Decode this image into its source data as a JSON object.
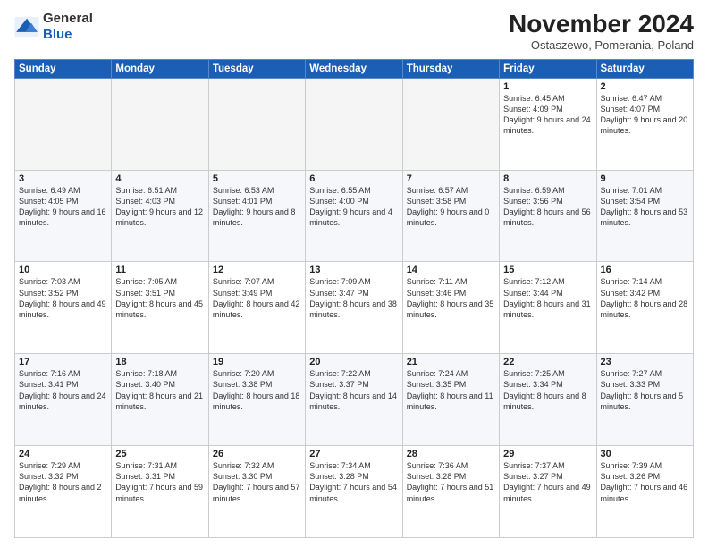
{
  "logo": {
    "general": "General",
    "blue": "Blue"
  },
  "title": "November 2024",
  "subtitle": "Ostaszewo, Pomerania, Poland",
  "weekdays": [
    "Sunday",
    "Monday",
    "Tuesday",
    "Wednesday",
    "Thursday",
    "Friday",
    "Saturday"
  ],
  "weeks": [
    [
      {
        "day": "",
        "info": ""
      },
      {
        "day": "",
        "info": ""
      },
      {
        "day": "",
        "info": ""
      },
      {
        "day": "",
        "info": ""
      },
      {
        "day": "",
        "info": ""
      },
      {
        "day": "1",
        "info": "Sunrise: 6:45 AM\nSunset: 4:09 PM\nDaylight: 9 hours and 24 minutes."
      },
      {
        "day": "2",
        "info": "Sunrise: 6:47 AM\nSunset: 4:07 PM\nDaylight: 9 hours and 20 minutes."
      }
    ],
    [
      {
        "day": "3",
        "info": "Sunrise: 6:49 AM\nSunset: 4:05 PM\nDaylight: 9 hours and 16 minutes."
      },
      {
        "day": "4",
        "info": "Sunrise: 6:51 AM\nSunset: 4:03 PM\nDaylight: 9 hours and 12 minutes."
      },
      {
        "day": "5",
        "info": "Sunrise: 6:53 AM\nSunset: 4:01 PM\nDaylight: 9 hours and 8 minutes."
      },
      {
        "day": "6",
        "info": "Sunrise: 6:55 AM\nSunset: 4:00 PM\nDaylight: 9 hours and 4 minutes."
      },
      {
        "day": "7",
        "info": "Sunrise: 6:57 AM\nSunset: 3:58 PM\nDaylight: 9 hours and 0 minutes."
      },
      {
        "day": "8",
        "info": "Sunrise: 6:59 AM\nSunset: 3:56 PM\nDaylight: 8 hours and 56 minutes."
      },
      {
        "day": "9",
        "info": "Sunrise: 7:01 AM\nSunset: 3:54 PM\nDaylight: 8 hours and 53 minutes."
      }
    ],
    [
      {
        "day": "10",
        "info": "Sunrise: 7:03 AM\nSunset: 3:52 PM\nDaylight: 8 hours and 49 minutes."
      },
      {
        "day": "11",
        "info": "Sunrise: 7:05 AM\nSunset: 3:51 PM\nDaylight: 8 hours and 45 minutes."
      },
      {
        "day": "12",
        "info": "Sunrise: 7:07 AM\nSunset: 3:49 PM\nDaylight: 8 hours and 42 minutes."
      },
      {
        "day": "13",
        "info": "Sunrise: 7:09 AM\nSunset: 3:47 PM\nDaylight: 8 hours and 38 minutes."
      },
      {
        "day": "14",
        "info": "Sunrise: 7:11 AM\nSunset: 3:46 PM\nDaylight: 8 hours and 35 minutes."
      },
      {
        "day": "15",
        "info": "Sunrise: 7:12 AM\nSunset: 3:44 PM\nDaylight: 8 hours and 31 minutes."
      },
      {
        "day": "16",
        "info": "Sunrise: 7:14 AM\nSunset: 3:42 PM\nDaylight: 8 hours and 28 minutes."
      }
    ],
    [
      {
        "day": "17",
        "info": "Sunrise: 7:16 AM\nSunset: 3:41 PM\nDaylight: 8 hours and 24 minutes."
      },
      {
        "day": "18",
        "info": "Sunrise: 7:18 AM\nSunset: 3:40 PM\nDaylight: 8 hours and 21 minutes."
      },
      {
        "day": "19",
        "info": "Sunrise: 7:20 AM\nSunset: 3:38 PM\nDaylight: 8 hours and 18 minutes."
      },
      {
        "day": "20",
        "info": "Sunrise: 7:22 AM\nSunset: 3:37 PM\nDaylight: 8 hours and 14 minutes."
      },
      {
        "day": "21",
        "info": "Sunrise: 7:24 AM\nSunset: 3:35 PM\nDaylight: 8 hours and 11 minutes."
      },
      {
        "day": "22",
        "info": "Sunrise: 7:25 AM\nSunset: 3:34 PM\nDaylight: 8 hours and 8 minutes."
      },
      {
        "day": "23",
        "info": "Sunrise: 7:27 AM\nSunset: 3:33 PM\nDaylight: 8 hours and 5 minutes."
      }
    ],
    [
      {
        "day": "24",
        "info": "Sunrise: 7:29 AM\nSunset: 3:32 PM\nDaylight: 8 hours and 2 minutes."
      },
      {
        "day": "25",
        "info": "Sunrise: 7:31 AM\nSunset: 3:31 PM\nDaylight: 7 hours and 59 minutes."
      },
      {
        "day": "26",
        "info": "Sunrise: 7:32 AM\nSunset: 3:30 PM\nDaylight: 7 hours and 57 minutes."
      },
      {
        "day": "27",
        "info": "Sunrise: 7:34 AM\nSunset: 3:28 PM\nDaylight: 7 hours and 54 minutes."
      },
      {
        "day": "28",
        "info": "Sunrise: 7:36 AM\nSunset: 3:28 PM\nDaylight: 7 hours and 51 minutes."
      },
      {
        "day": "29",
        "info": "Sunrise: 7:37 AM\nSunset: 3:27 PM\nDaylight: 7 hours and 49 minutes."
      },
      {
        "day": "30",
        "info": "Sunrise: 7:39 AM\nSunset: 3:26 PM\nDaylight: 7 hours and 46 minutes."
      }
    ]
  ]
}
